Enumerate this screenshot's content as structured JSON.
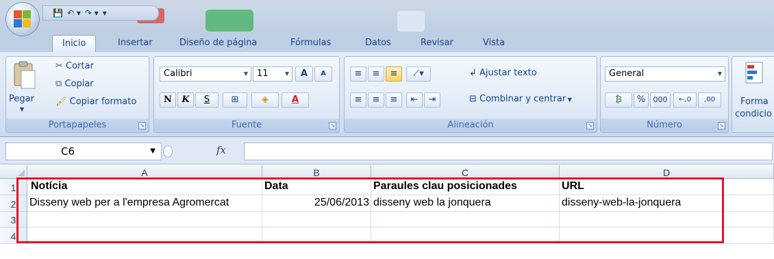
{
  "qat": {
    "save": "💾",
    "undo": "↶ ▾",
    "redo": "↷ ▾",
    "more": "▾"
  },
  "tabs": [
    "Inicio",
    "Insertar",
    "Diseño de página",
    "Fórmulas",
    "Datos",
    "Revisar",
    "Vista"
  ],
  "ribbon": {
    "clipboard": {
      "paste": "Pegar",
      "cut": "Cortar",
      "copy": "Copiar",
      "format_painter": "Copiar formato",
      "label": "Portapapeles"
    },
    "font": {
      "name": "Calibri",
      "size": "11",
      "grow": "A",
      "shrink": "A",
      "bold": "N",
      "italic": "K",
      "underline": "S",
      "border": "⊞",
      "fill": "◈",
      "color": "A",
      "label": "Fuente"
    },
    "alignment": {
      "wrap": "Ajustar texto",
      "merge": "Combinar y centrar",
      "label": "Alineación"
    },
    "number": {
      "format": "General",
      "currency": "₿",
      "percent": "%",
      "thousands": "000",
      "inc_dec": "←,0",
      "dec_dec": ",00",
      "label": "Número"
    },
    "styles": {
      "cond_format_1": "Forma",
      "cond_format_2": "condicio"
    }
  },
  "formula_bar": {
    "cell_ref": "C6",
    "fx": "fx",
    "value": ""
  },
  "columns": [
    "A",
    "B",
    "C",
    "D"
  ],
  "rows": [
    "1",
    "2",
    "3",
    "4"
  ],
  "cells": {
    "A1": "Notícia",
    "B1": "Data",
    "C1": "Paraules clau posicionades",
    "D1": "URL",
    "A2": "Disseny web per a l'empresa Agromercat",
    "B2": "25/06/2013",
    "C2": "disseny web la jonquera",
    "D2": "disseny-web-la-jonquera"
  },
  "colors": {
    "highlight_box": "#e0172b",
    "ribbon_text": "#15428b"
  }
}
